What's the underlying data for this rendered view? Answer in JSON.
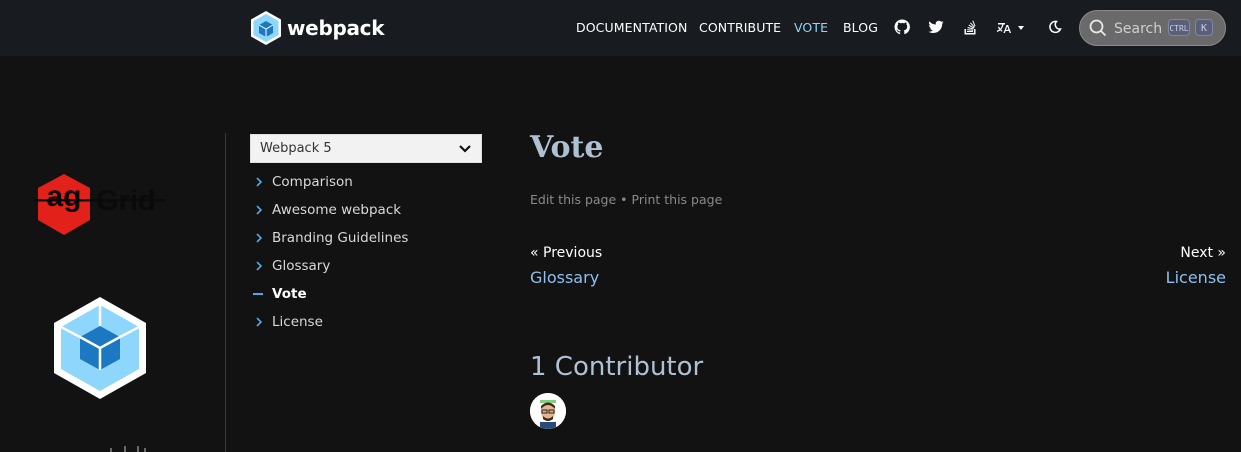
{
  "header": {
    "brand": "webpack",
    "nav": [
      {
        "label": "DOCUMENTATION",
        "active": false
      },
      {
        "label": "CONTRIBUTE",
        "active": false
      },
      {
        "label": "VOTE",
        "active": true
      },
      {
        "label": "BLOG",
        "active": false
      }
    ],
    "icons": [
      "github-icon",
      "twitter-icon",
      "stackoverflow-icon",
      "language-icon",
      "theme-toggle-icon"
    ],
    "search": {
      "placeholder": "Search",
      "kbd_ctrl": "CTRL",
      "kbd_key": "K"
    }
  },
  "ads": {
    "sponsor": "ag Grid"
  },
  "sidebar": {
    "version_select": "Webpack 5",
    "items": [
      {
        "label": "Comparison",
        "current": false
      },
      {
        "label": "Awesome webpack",
        "current": false
      },
      {
        "label": "Branding Guidelines",
        "current": false
      },
      {
        "label": "Glossary",
        "current": false
      },
      {
        "label": "Vote",
        "current": true
      },
      {
        "label": "License",
        "current": false
      }
    ]
  },
  "main": {
    "title": "Vote",
    "edit_link": "Edit this page",
    "separator": "•",
    "print_link": "Print this page",
    "prev_label": "« Previous",
    "prev_link": "Glossary",
    "next_label": "Next »",
    "next_link": "License",
    "contributors_heading": "1 Contributor"
  },
  "colors": {
    "accent": "#8dd6f9",
    "link": "#8dc0f0",
    "heading": "#aec0d2",
    "background": "#121212"
  }
}
